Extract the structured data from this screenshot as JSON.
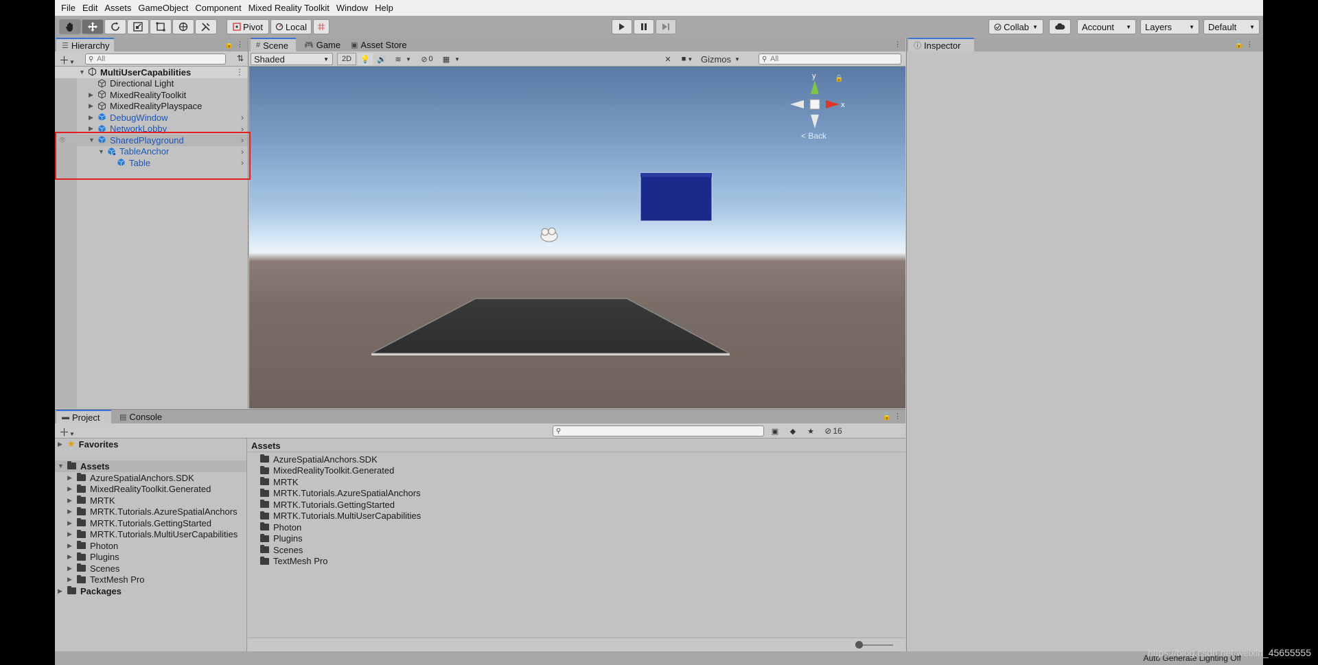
{
  "menu": [
    "File",
    "Edit",
    "Assets",
    "GameObject",
    "Component",
    "Mixed Reality Toolkit",
    "Window",
    "Help"
  ],
  "toolbar": {
    "pivot_label": "Pivot",
    "local_label": "Local",
    "collab_label": "Collab",
    "account_label": "Account",
    "layers_label": "Layers",
    "layout_label": "Default"
  },
  "hierarchy": {
    "tab_label": "Hierarchy",
    "search_placeholder": "All",
    "scene_name": "MultiUserCapabilities",
    "items": [
      {
        "label": "Directional Light"
      },
      {
        "label": "MixedRealityToolkit"
      },
      {
        "label": "MixedRealityPlayspace"
      },
      {
        "label": "DebugWindow"
      },
      {
        "label": "NetworkLobby"
      },
      {
        "label": "SharedPlayground"
      },
      {
        "label": "TableAnchor"
      },
      {
        "label": "Table"
      }
    ]
  },
  "scene": {
    "tabs": [
      "Scene",
      "Game",
      "Asset Store"
    ],
    "shading_mode": "Shaded",
    "mode_2d": "2D",
    "hidden_count": "0",
    "gizmos_label": "Gizmos",
    "search_placeholder": "All",
    "gizmo_back_label": "< Back",
    "gizmo_axis_y": "y",
    "gizmo_axis_x": "x"
  },
  "inspector": {
    "tab_label": "Inspector"
  },
  "project": {
    "tabs": [
      "Project",
      "Console"
    ],
    "hidden_count": "16",
    "favorites_label": "Favorites",
    "assets_label": "Assets",
    "packages_label": "Packages",
    "breadcrumb": "Assets",
    "tree_folders": [
      "AzureSpatialAnchors.SDK",
      "MixedRealityToolkit.Generated",
      "MRTK",
      "MRTK.Tutorials.AzureSpatialAnchors",
      "MRTK.Tutorials.GettingStarted",
      "MRTK.Tutorials.MultiUserCapabilities",
      "Photon",
      "Plugins",
      "Scenes",
      "TextMesh Pro"
    ],
    "main_folders": [
      "AzureSpatialAnchors.SDK",
      "MixedRealityToolkit.Generated",
      "MRTK",
      "MRTK.Tutorials.AzureSpatialAnchors",
      "MRTK.Tutorials.GettingStarted",
      "MRTK.Tutorials.MultiUserCapabilities",
      "Photon",
      "Plugins",
      "Scenes",
      "TextMesh Pro"
    ]
  },
  "status": {
    "message": "Auto Generate Lighting Off"
  },
  "watermark": "https://blog.csdn.net/weixin_45655555",
  "colors": {
    "accent": "#3a72d8",
    "prefab_blue": "#1c56b8",
    "highlight_red": "#e02020"
  }
}
